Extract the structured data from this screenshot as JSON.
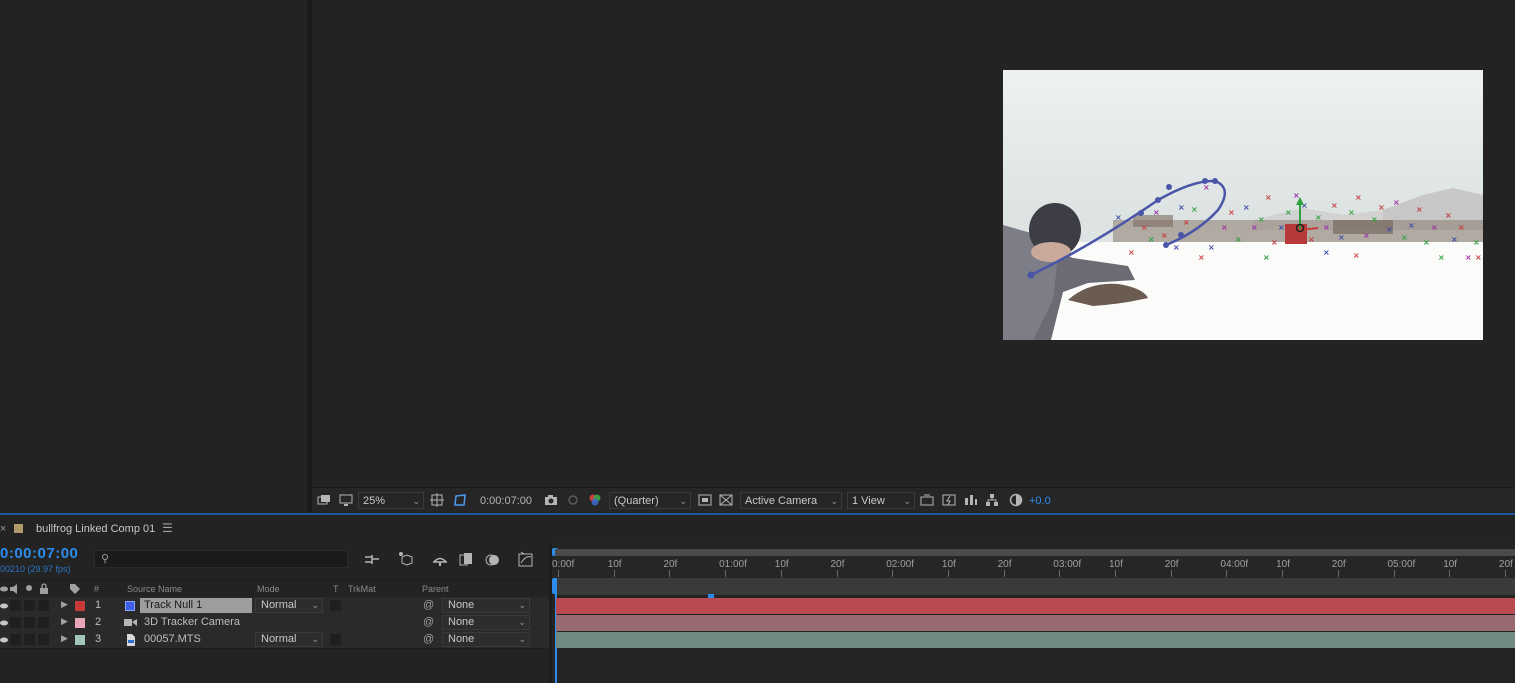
{
  "viewer": {
    "zoom": "25%",
    "timecode": "0:00:07:00",
    "resolution": "(Quarter)",
    "camera": "Active Camera",
    "views": "1 View",
    "exposure": "+0.0"
  },
  "timeline": {
    "tab_title": "bullfrog Linked Comp 01",
    "current_time": "0:00:07:00",
    "frame_info": "00210 (29.97 fps)",
    "columns": {
      "number": "#",
      "source_name": "Source Name",
      "mode": "Mode",
      "t": "T",
      "trkmat": "TrkMat",
      "parent": "Parent"
    },
    "ruler_labels": [
      "0:00f",
      "10f",
      "20f",
      "01:00f",
      "10f",
      "20f",
      "02:00f",
      "10f",
      "20f",
      "03:00f",
      "10f",
      "20f",
      "04:00f",
      "10f",
      "20f",
      "05:00f",
      "10f",
      "20f"
    ],
    "layers": [
      {
        "num": "1",
        "name": "Track Null 1",
        "mode": "Normal",
        "parent": "None",
        "label_color": "#c83a3a",
        "bar_color": "#b94a52"
      },
      {
        "num": "2",
        "name": "3D Tracker Camera",
        "mode": "",
        "parent": "None",
        "label_color": "#e8a7b6",
        "bar_color": "#9a6a73"
      },
      {
        "num": "3",
        "name": "00057.MTS",
        "mode": "Normal",
        "parent": "None",
        "label_color": "#9fc8b9",
        "bar_color": "#6f8a7f"
      }
    ]
  },
  "colors": {
    "accent_blue": "#2d8ceb",
    "panel_bg": "#232323"
  }
}
